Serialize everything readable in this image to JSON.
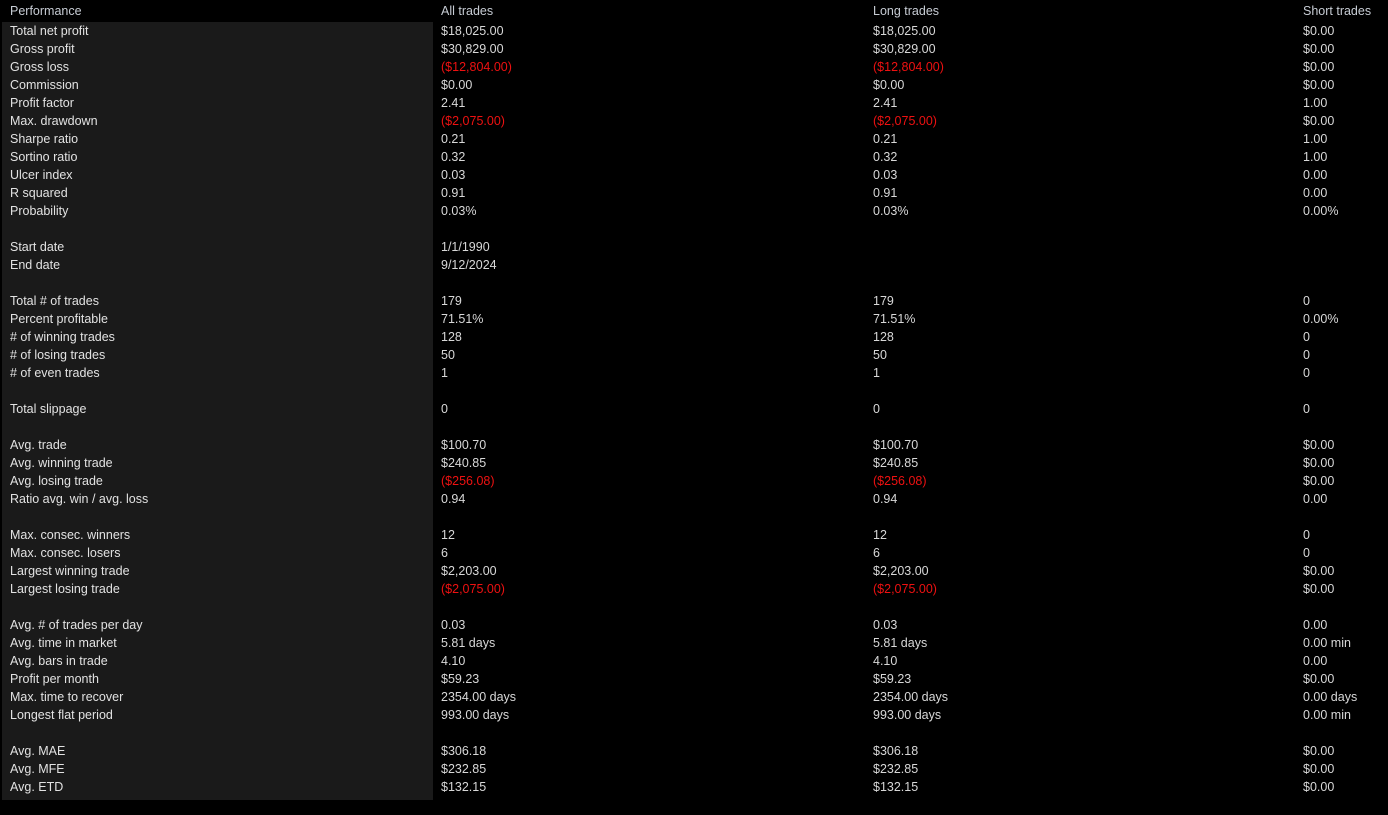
{
  "report": {
    "title": "Performance",
    "columns": [
      "Performance",
      "All trades",
      "Long trades",
      "Short trades"
    ],
    "colors": {
      "background": "#000000",
      "label_panel": "#1a1a1a",
      "header_text": "#c7ccd4",
      "value_text": "#d8d8d8",
      "negative_text": "#ee1111"
    },
    "rows": [
      {
        "label": "Total net profit",
        "all": "$18,025.00",
        "long": "$18,025.00",
        "short": "$0.00"
      },
      {
        "label": "Gross profit",
        "all": "$30,829.00",
        "long": "$30,829.00",
        "short": "$0.00"
      },
      {
        "label": "Gross loss",
        "all": "($12,804.00)",
        "long": "($12,804.00)",
        "short": "$0.00",
        "neg": [
          "all",
          "long"
        ]
      },
      {
        "label": "Commission",
        "all": "$0.00",
        "long": "$0.00",
        "short": "$0.00"
      },
      {
        "label": "Profit factor",
        "all": "2.41",
        "long": "2.41",
        "short": "1.00"
      },
      {
        "label": "Max. drawdown",
        "all": "($2,075.00)",
        "long": "($2,075.00)",
        "short": "$0.00",
        "neg": [
          "all",
          "long"
        ]
      },
      {
        "label": "Sharpe ratio",
        "all": "0.21",
        "long": "0.21",
        "short": "1.00"
      },
      {
        "label": "Sortino ratio",
        "all": "0.32",
        "long": "0.32",
        "short": "1.00"
      },
      {
        "label": "Ulcer index",
        "all": "0.03",
        "long": "0.03",
        "short": "0.00"
      },
      {
        "label": "R squared",
        "all": "0.91",
        "long": "0.91",
        "short": "0.00"
      },
      {
        "label": "Probability",
        "all": "0.03%",
        "long": "0.03%",
        "short": "0.00%"
      },
      {
        "spacer": true
      },
      {
        "label": "Start date",
        "all": "1/1/1990",
        "long": "",
        "short": ""
      },
      {
        "label": "End date",
        "all": "9/12/2024",
        "long": "",
        "short": ""
      },
      {
        "spacer": true
      },
      {
        "label": "Total # of trades",
        "all": "179",
        "long": "179",
        "short": "0"
      },
      {
        "label": "Percent profitable",
        "all": "71.51%",
        "long": "71.51%",
        "short": "0.00%"
      },
      {
        "label": "# of winning trades",
        "all": "128",
        "long": "128",
        "short": "0"
      },
      {
        "label": "# of losing trades",
        "all": "50",
        "long": "50",
        "short": "0"
      },
      {
        "label": "# of even trades",
        "all": "1",
        "long": "1",
        "short": "0"
      },
      {
        "spacer": true
      },
      {
        "label": "Total slippage",
        "all": "0",
        "long": "0",
        "short": "0"
      },
      {
        "spacer": true
      },
      {
        "label": "Avg. trade",
        "all": "$100.70",
        "long": "$100.70",
        "short": "$0.00"
      },
      {
        "label": "Avg. winning trade",
        "all": "$240.85",
        "long": "$240.85",
        "short": "$0.00"
      },
      {
        "label": "Avg. losing trade",
        "all": "($256.08)",
        "long": "($256.08)",
        "short": "$0.00",
        "neg": [
          "all",
          "long"
        ]
      },
      {
        "label": "Ratio avg. win / avg. loss",
        "all": "0.94",
        "long": "0.94",
        "short": "0.00"
      },
      {
        "spacer": true
      },
      {
        "label": "Max. consec. winners",
        "all": "12",
        "long": "12",
        "short": "0"
      },
      {
        "label": "Max. consec. losers",
        "all": "6",
        "long": "6",
        "short": "0"
      },
      {
        "label": "Largest winning trade",
        "all": "$2,203.00",
        "long": "$2,203.00",
        "short": "$0.00"
      },
      {
        "label": "Largest losing trade",
        "all": "($2,075.00)",
        "long": "($2,075.00)",
        "short": "$0.00",
        "neg": [
          "all",
          "long"
        ]
      },
      {
        "spacer": true
      },
      {
        "label": "Avg. # of trades per day",
        "all": "0.03",
        "long": "0.03",
        "short": "0.00"
      },
      {
        "label": "Avg. time in market",
        "all": "5.81 days",
        "long": "5.81 days",
        "short": "0.00 min"
      },
      {
        "label": "Avg. bars in trade",
        "all": "4.10",
        "long": "4.10",
        "short": "0.00"
      },
      {
        "label": "Profit per month",
        "all": "$59.23",
        "long": "$59.23",
        "short": "$0.00"
      },
      {
        "label": "Max. time to recover",
        "all": "2354.00 days",
        "long": "2354.00 days",
        "short": "0.00 days"
      },
      {
        "label": "Longest flat period",
        "all": "993.00 days",
        "long": "993.00 days",
        "short": "0.00 min"
      },
      {
        "spacer": true
      },
      {
        "label": "Avg. MAE",
        "all": "$306.18",
        "long": "$306.18",
        "short": "$0.00"
      },
      {
        "label": "Avg. MFE",
        "all": "$232.85",
        "long": "$232.85",
        "short": "$0.00"
      },
      {
        "label": "Avg. ETD",
        "all": "$132.15",
        "long": "$132.15",
        "short": "$0.00"
      }
    ]
  }
}
